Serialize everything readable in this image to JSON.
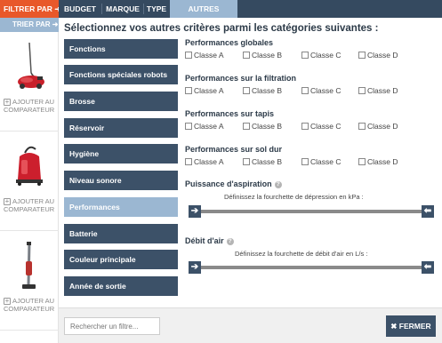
{
  "left": {
    "filter_label": "FILTRER PAR",
    "sort_label": "TRIER PAR",
    "products": [
      {
        "compare_line1": "AJOUTER AU",
        "compare_line2": "COMPARATEUR",
        "image": "red-canister-vacuum-image"
      },
      {
        "compare_line1": "AJOUTER AU",
        "compare_line2": "COMPARATEUR",
        "image": "red-drum-vacuum-image"
      },
      {
        "compare_line1": "AJOUTER AU",
        "compare_line2": "COMPARATEUR",
        "image": "stick-vacuum-image"
      }
    ]
  },
  "nav": {
    "tabs": [
      "BUDGET",
      "MARQUE",
      "TYPE",
      "AUTRES CRITÈRES"
    ],
    "active": "AUTRES CRITÈRES"
  },
  "panel": {
    "title": "Sélectionnez vos autres critères parmi les catégories suivantes :",
    "categories": [
      "Fonctions",
      "Fonctions spéciales robots",
      "Brosse",
      "Réservoir",
      "Hygiène",
      "Niveau sonore",
      "Performances",
      "Batterie",
      "Couleur principale",
      "Année de sortie"
    ],
    "active_category": "Performances",
    "sections": [
      {
        "title": "Performances globales",
        "options": [
          "Classe A",
          "Classe B",
          "Classe C",
          "Classe D"
        ]
      },
      {
        "title": "Performances sur la filtration",
        "options": [
          "Classe A",
          "Classe B",
          "Classe C",
          "Classe D"
        ]
      },
      {
        "title": "Performances sur tapis",
        "options": [
          "Classe A",
          "Classe B",
          "Classe C",
          "Classe D"
        ]
      },
      {
        "title": "Performances sur sol dur",
        "options": [
          "Classe A",
          "Classe B",
          "Classe C",
          "Classe D"
        ]
      }
    ],
    "ranges": [
      {
        "title": "Puissance d'aspiration",
        "help": "?",
        "description": "Définissez la fourchette de dépression en kPa :"
      },
      {
        "title": "Débit d'air",
        "help": "?",
        "description": "Définissez la fourchette de débit d'air en L/s :"
      }
    ]
  },
  "footer": {
    "search_placeholder": "Rechercher un filtre...",
    "close_label": "FERMER"
  },
  "colors": {
    "orange": "#e8582a",
    "navy": "#354a60",
    "category": "#3c5168",
    "active_blue": "#9bb7d2"
  }
}
